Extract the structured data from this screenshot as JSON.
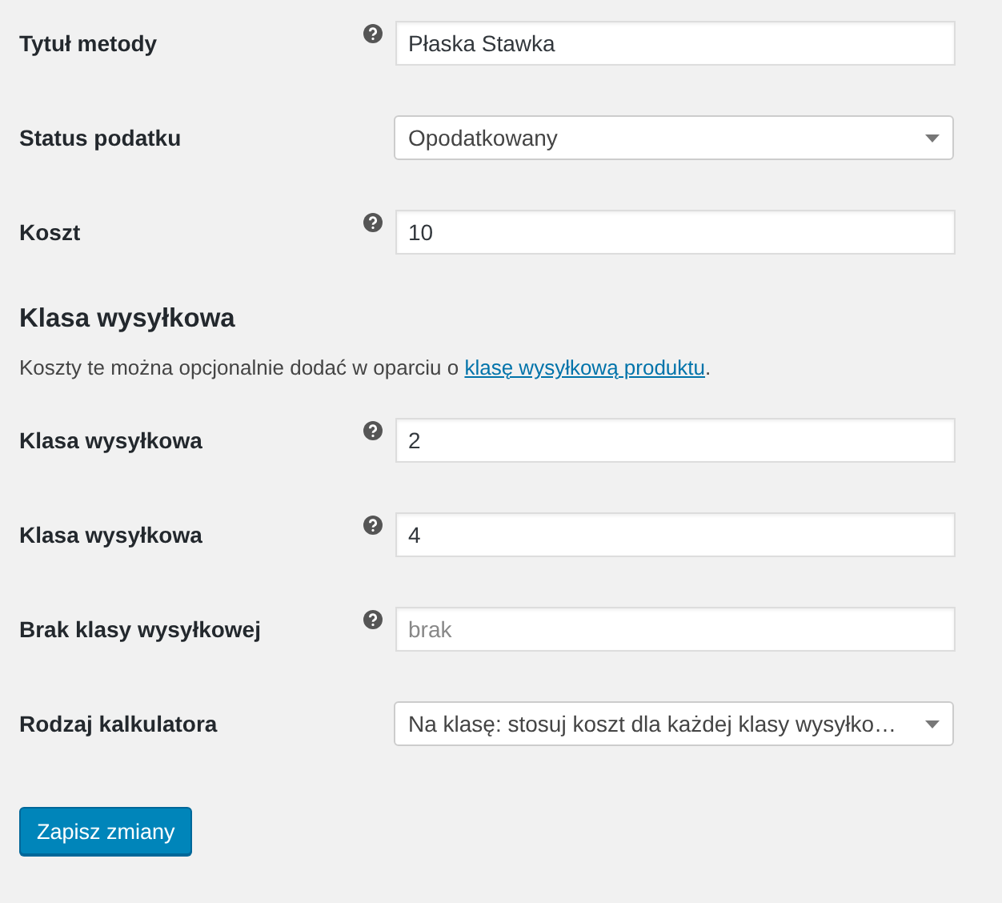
{
  "fields": [
    {
      "label": "Tytuł metody",
      "help": true,
      "kind": "text",
      "value": "Płaska Stawka"
    },
    {
      "label": "Status podatku",
      "help": false,
      "kind": "select",
      "value": "Opodatkowany"
    },
    {
      "label": "Koszt",
      "help": true,
      "kind": "text",
      "value": "10"
    }
  ],
  "section": {
    "heading": "Klasa wysyłkowa",
    "description": {
      "before": "Koszty te można opcjonalnie dodać w oparciu o ",
      "link": "klasę wysyłkową produktu",
      "after": "."
    }
  },
  "class_fields": [
    {
      "label": "Klasa wysyłkowa",
      "help": true,
      "kind": "text",
      "value": "2"
    },
    {
      "label": "Klasa wysyłkowa",
      "help": true,
      "kind": "text",
      "value": "4"
    },
    {
      "label": "Brak klasy wysyłkowej",
      "help": true,
      "kind": "text",
      "placeholder": "brak"
    },
    {
      "label": "Rodzaj kalkulatora",
      "help": false,
      "kind": "select",
      "value": "Na klasę: stosuj koszt dla każdej klasy wysyłko…"
    }
  ],
  "save_button": "Zapisz zmiany"
}
